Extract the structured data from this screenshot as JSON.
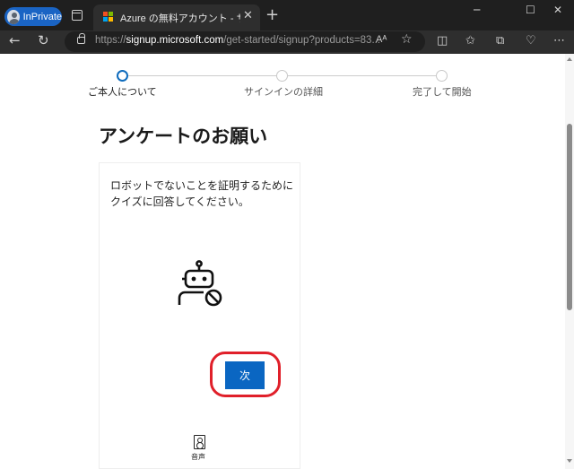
{
  "browser": {
    "inprivate_label": "InPrivate",
    "tab_title": "Azure の無料アカウント - サインアップ",
    "tab_close": "✕",
    "new_tab": "+",
    "url_scheme": "https://",
    "url_host": "signup.microsoft.com",
    "url_rest": "/get-started/signup?products=83...",
    "read_aloud": "Aᴬ",
    "favicon_colors": [
      "#f25022",
      "#7fba00",
      "#00a4ef",
      "#ffb900"
    ],
    "accent": "#1a64c4"
  },
  "steps": [
    {
      "label": "ご本人について",
      "active": true
    },
    {
      "label": "サインインの詳細",
      "active": false
    },
    {
      "label": "完了して開始",
      "active": false
    }
  ],
  "page": {
    "heading": "アンケートのお願い",
    "instruction": "ロボットでないことを証明するために クイズに回答してください。",
    "next_button": "次",
    "audio_label": "音声",
    "primary_color": "#0a66c2",
    "highlight_color": "#e0202a"
  },
  "icons": {
    "robot": "robot-blocked-icon",
    "audio": "speaker-icon"
  }
}
